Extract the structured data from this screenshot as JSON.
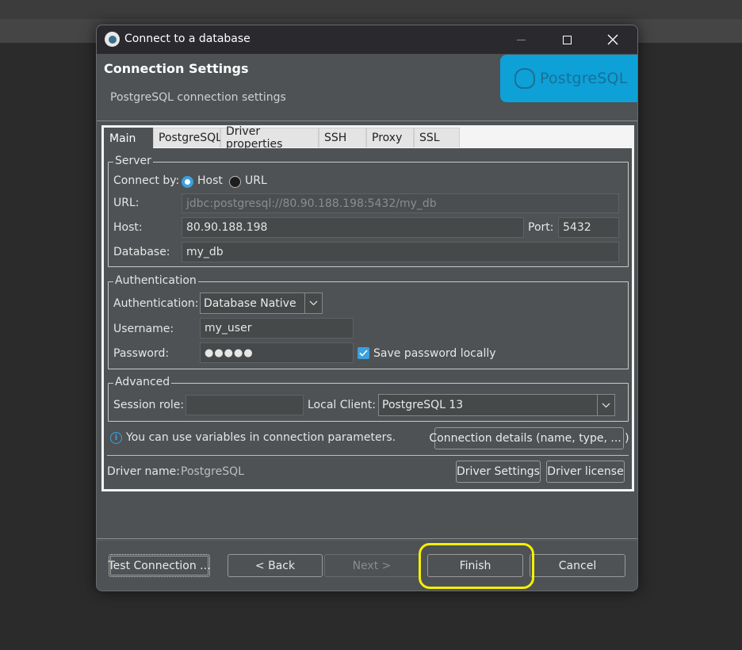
{
  "window": {
    "title": "Connect to a database"
  },
  "header": {
    "title": "Connection Settings",
    "subtitle": "PostgreSQL connection settings",
    "logo_text": "PostgreSQL"
  },
  "tabs": [
    {
      "label": "Main",
      "active": true
    },
    {
      "label": "PostgreSQL",
      "active": false
    },
    {
      "label": "Driver properties",
      "active": false
    },
    {
      "label": "SSH",
      "active": false
    },
    {
      "label": "Proxy",
      "active": false
    },
    {
      "label": "SSL",
      "active": false
    }
  ],
  "server": {
    "legend": "Server",
    "connect_by_label": "Connect by:",
    "host_option": "Host",
    "url_option": "URL",
    "selected": "Host",
    "url_label": "URL:",
    "url_value": "jdbc:postgresql://80.90.188.198:5432/my_db",
    "host_label": "Host:",
    "host_value": "80.90.188.198",
    "port_label": "Port:",
    "port_value": "5432",
    "database_label": "Database:",
    "database_value": "my_db"
  },
  "auth": {
    "legend": "Authentication",
    "auth_label": "Authentication:",
    "auth_value": "Database Native",
    "username_label": "Username:",
    "username_value": "my_user",
    "password_label": "Password:",
    "password_value": "●●●●●",
    "save_password_label": "Save password locally",
    "save_password_checked": true
  },
  "advanced": {
    "legend": "Advanced",
    "session_role_label": "Session role:",
    "session_role_value": "",
    "local_client_label": "Local Client:",
    "local_client_value": "PostgreSQL 13"
  },
  "info": {
    "text": "You can use variables in connection parameters.",
    "details_button": "Connection details (name, type, ... )"
  },
  "driver": {
    "name_label": "Driver name:",
    "name_value": "PostgreSQL",
    "settings_button": "Driver Settings",
    "license_button": "Driver license"
  },
  "footer": {
    "test_connection": "Test Connection ...",
    "back": "< Back",
    "next": "Next >",
    "finish": "Finish",
    "cancel": "Cancel"
  },
  "colors": {
    "accent": "#3ba0dd",
    "highlight": "#f5f000",
    "logo_bg": "#0da1d8"
  }
}
